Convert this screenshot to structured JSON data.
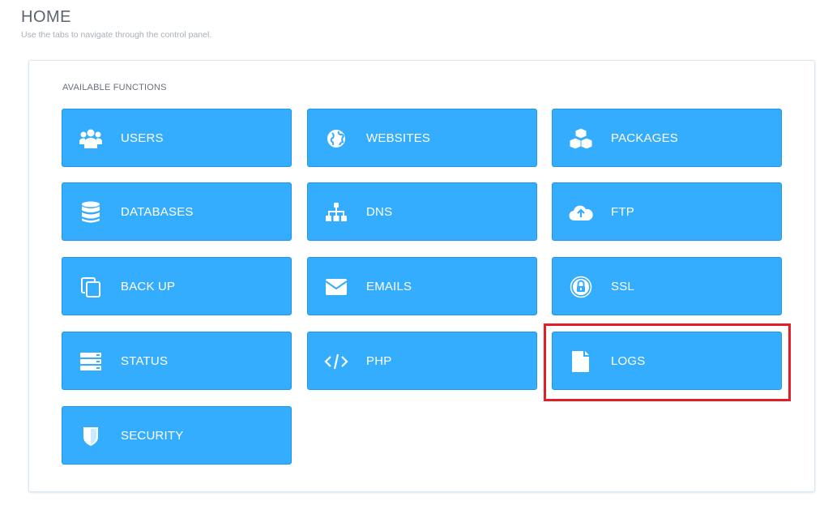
{
  "header": {
    "title": "HOME",
    "subtitle": "Use the tabs to navigate through the control panel."
  },
  "panel": {
    "label": "AVAILABLE FUNCTIONS",
    "tiles": [
      {
        "label": "USERS",
        "icon": "users-icon"
      },
      {
        "label": "WEBSITES",
        "icon": "globe-icon"
      },
      {
        "label": "PACKAGES",
        "icon": "cubes-icon"
      },
      {
        "label": "DATABASES",
        "icon": "database-icon"
      },
      {
        "label": "DNS",
        "icon": "sitemap-icon"
      },
      {
        "label": "FTP",
        "icon": "cloud-upload-icon"
      },
      {
        "label": "BACK UP",
        "icon": "copy-icon"
      },
      {
        "label": "EMAILS",
        "icon": "envelope-icon"
      },
      {
        "label": "SSL",
        "icon": "lock-icon"
      },
      {
        "label": "STATUS",
        "icon": "server-icon"
      },
      {
        "label": "PHP",
        "icon": "code-icon"
      },
      {
        "label": "LOGS",
        "icon": "file-icon"
      },
      {
        "label": "SECURITY",
        "icon": "shield-icon"
      }
    ]
  },
  "highlight": {
    "target": "LOGS",
    "color": "#e31e24"
  },
  "colors": {
    "tile_bg": "#35adfe",
    "tile_border": "#1f96e8",
    "tile_text": "#ffffff"
  }
}
